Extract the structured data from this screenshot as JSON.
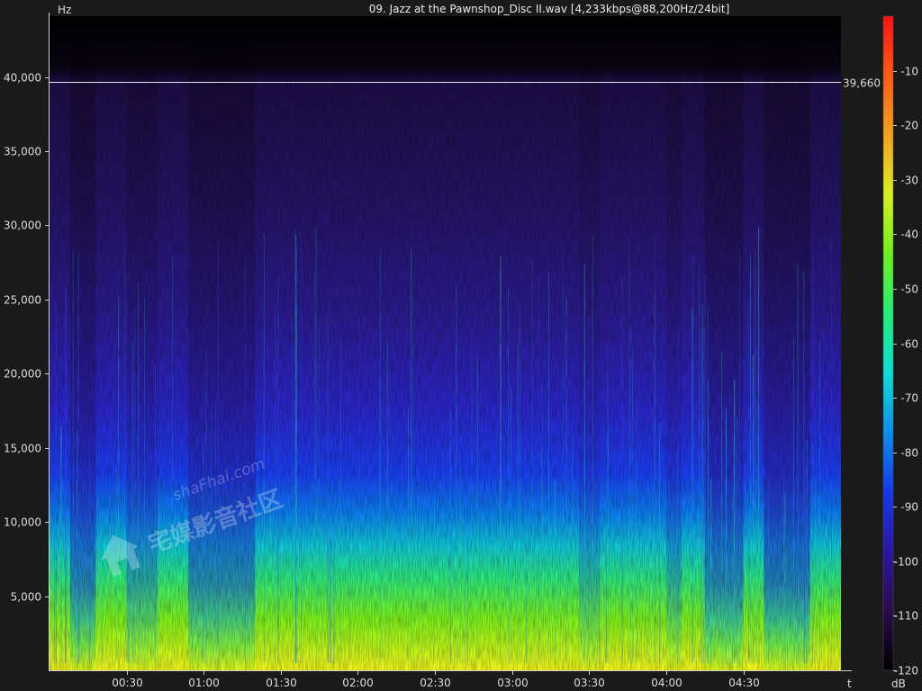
{
  "title": "09. Jazz at the Pawnshop_Disc II.wav [4,233kbps@88,200Hz/24bit]",
  "chart_data": {
    "type": "heatmap",
    "title": "09. Jazz at the Pawnshop_Disc II.wav [4,233kbps@88,200Hz/24bit]",
    "xlabel": "t",
    "ylabel": "Hz",
    "x_unit": "seconds",
    "x_range": [
      0,
      308
    ],
    "y_range": [
      0,
      44100
    ],
    "x_ticks": [
      {
        "value": 30,
        "label": "00:30"
      },
      {
        "value": 60,
        "label": "01:00"
      },
      {
        "value": 90,
        "label": "01:30"
      },
      {
        "value": 120,
        "label": "02:00"
      },
      {
        "value": 150,
        "label": "02:30"
      },
      {
        "value": 180,
        "label": "03:00"
      },
      {
        "value": 210,
        "label": "03:30"
      },
      {
        "value": 240,
        "label": "04:00"
      },
      {
        "value": 270,
        "label": "04:30"
      }
    ],
    "y_ticks": [
      {
        "value": 5000,
        "label": "5,000"
      },
      {
        "value": 10000,
        "label": "10,000"
      },
      {
        "value": 15000,
        "label": "15,000"
      },
      {
        "value": 20000,
        "label": "20,000"
      },
      {
        "value": 25000,
        "label": "25,000"
      },
      {
        "value": 30000,
        "label": "30,000"
      },
      {
        "value": 35000,
        "label": "35,000"
      },
      {
        "value": 40000,
        "label": "40,000"
      }
    ],
    "cutoff": {
      "value": 39660,
      "label": "39,660"
    },
    "colorbar": {
      "unit": "dB",
      "range": [
        -120,
        0
      ],
      "ticks": [
        {
          "value": -10,
          "label": "-10"
        },
        {
          "value": -20,
          "label": "-20"
        },
        {
          "value": -30,
          "label": "-30"
        },
        {
          "value": -40,
          "label": "-40"
        },
        {
          "value": -50,
          "label": "-50"
        },
        {
          "value": -60,
          "label": "-60"
        },
        {
          "value": -70,
          "label": "-70"
        },
        {
          "value": -80,
          "label": "-80"
        },
        {
          "value": -90,
          "label": "-90"
        },
        {
          "value": -100,
          "label": "-100"
        },
        {
          "value": -110,
          "label": "-110"
        },
        {
          "value": -120,
          "label": "-120"
        }
      ],
      "colors": [
        "#000000",
        "#2a0b4d",
        "#2b15a8",
        "#1238f0",
        "#0a8ff0",
        "#0ae0d8",
        "#1ff07a",
        "#6cf21a",
        "#d8f01a",
        "#f6a21a",
        "#ff5a14",
        "#ff1010"
      ]
    }
  },
  "watermark": {
    "url": "shaFhai.com",
    "text": "宅媒影音社区"
  }
}
